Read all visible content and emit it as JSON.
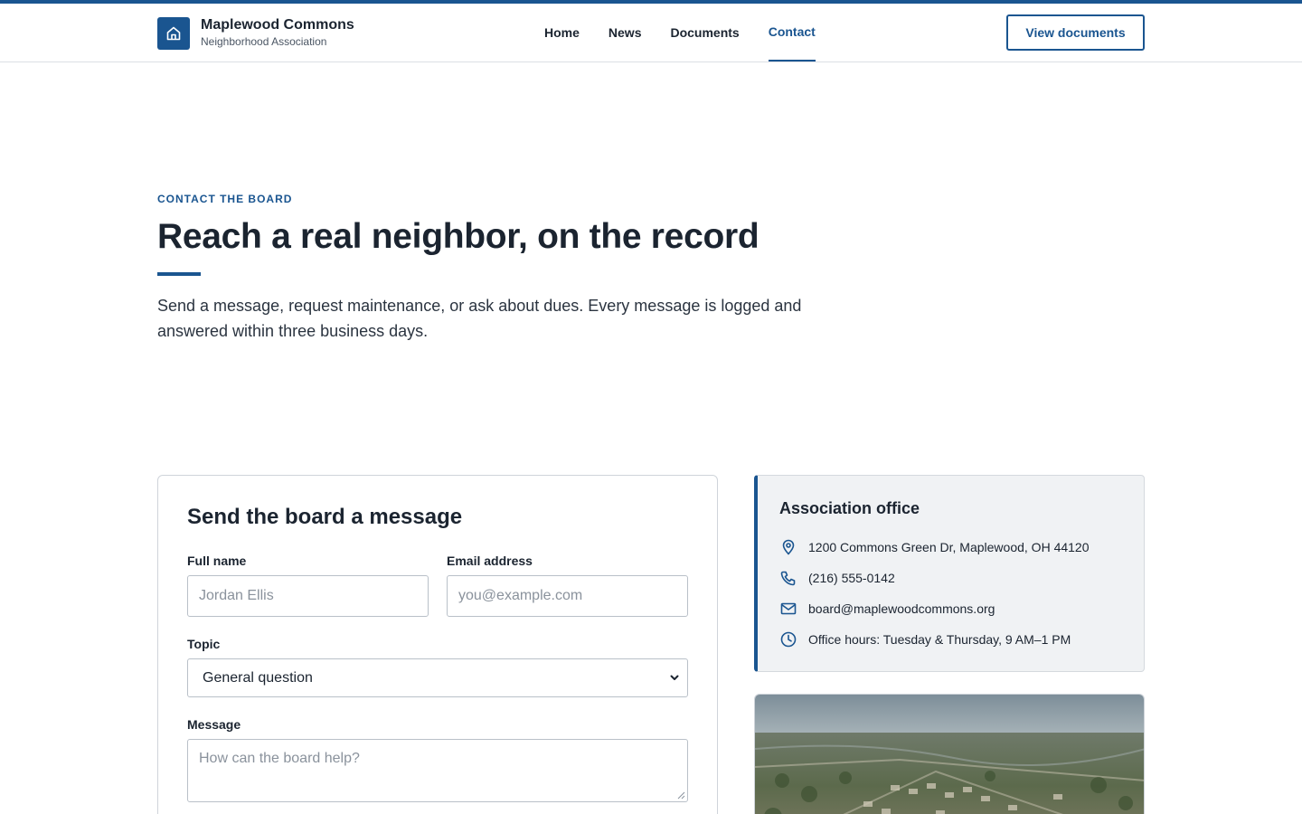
{
  "header": {
    "brand_name": "Maplewood Commons",
    "brand_sub": "Neighborhood Association",
    "nav": [
      {
        "label": "Home"
      },
      {
        "label": "News"
      },
      {
        "label": "Documents"
      },
      {
        "label": "Contact"
      }
    ],
    "active_nav": "Contact",
    "cta_label": "View documents"
  },
  "hero": {
    "eyebrow": "CONTACT THE BOARD",
    "title": "Reach a real neighbor, on the record",
    "lead": "Send a message, request maintenance, or ask about dues. Every message is logged and answered within three business days."
  },
  "form": {
    "title": "Send the board a message",
    "name_label": "Full name",
    "name_placeholder": "Jordan Ellis",
    "email_label": "Email address",
    "email_placeholder": "you@example.com",
    "topic_label": "Topic",
    "topic_value": "General question",
    "message_label": "Message",
    "message_placeholder": "How can the board help?"
  },
  "office": {
    "title": "Association office",
    "items": [
      {
        "icon": "map-pin-icon",
        "text": "1200 Commons Green Dr, Maplewood, OH 44120"
      },
      {
        "icon": "phone-icon",
        "text": "(216) 555-0142"
      },
      {
        "icon": "mail-icon",
        "text": "board@maplewoodcommons.org"
      },
      {
        "icon": "clock-icon",
        "text": "Office hours: Tuesday & Thursday, 9 AM–1 PM"
      }
    ]
  },
  "colors": {
    "accent": "#1a5590",
    "text": "#1b2430",
    "card_bg": "#f0f2f4"
  }
}
